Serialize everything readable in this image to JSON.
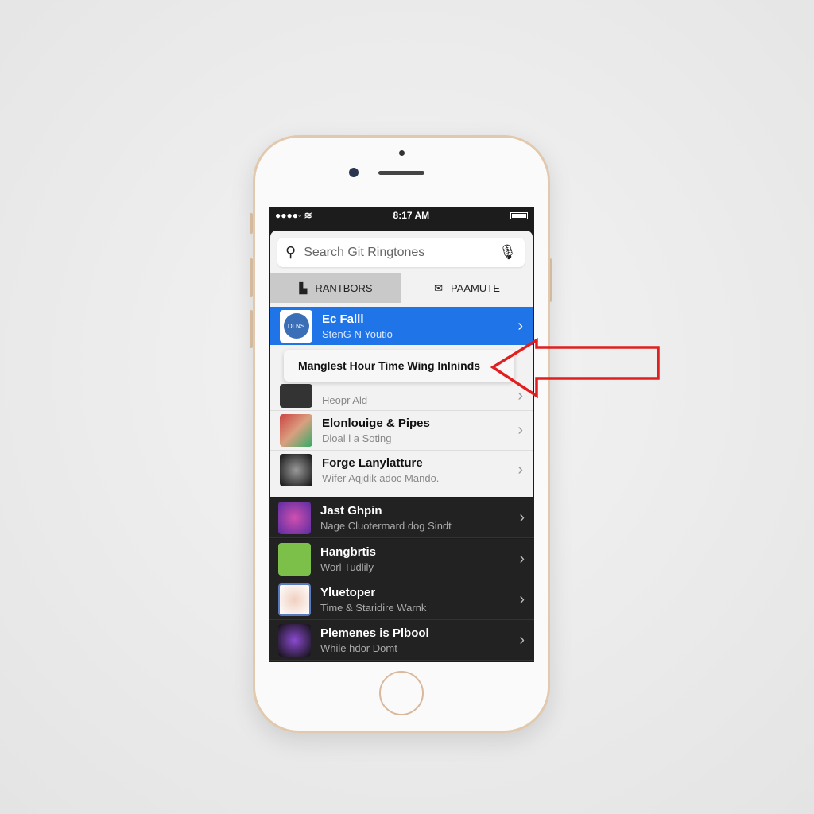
{
  "status_bar": {
    "time": "8:17 AM"
  },
  "search": {
    "placeholder": "Search Git Ringtones"
  },
  "tabs": [
    {
      "label": "RANTBORS",
      "active": true
    },
    {
      "label": "PAAMUTE",
      "active": false
    }
  ],
  "list_light": [
    {
      "title": "Ec Falll",
      "subtitle": "StenG N Youtio",
      "selected": true,
      "thumb_label": "DI NS"
    },
    {
      "title": "",
      "subtitle": "Heopr Ald"
    },
    {
      "title": "Elonlouige & Pipes",
      "subtitle": "Dloal l a Soting"
    },
    {
      "title": "Forge Lanylatture",
      "subtitle": "Wifer Aqjdik adoc Mando."
    }
  ],
  "tooltip": {
    "text": "Manglest Hour Time Wing lnlninds"
  },
  "list_dark": [
    {
      "title": "Jast Ghpin",
      "subtitle": "Nage Cluotermard dog Sindt"
    },
    {
      "title": "Hangbrtis",
      "subtitle": "Worl Tudlily"
    },
    {
      "title": "Yluetoper",
      "subtitle": "Time & Staridire Warnk"
    },
    {
      "title": "Plemenes is Plbool",
      "subtitle": "While hdor Domt"
    }
  ],
  "colors": {
    "accent": "#1f74e8",
    "annotation_arrow": "#e02020",
    "phone_trim": "#e2c9ae"
  }
}
